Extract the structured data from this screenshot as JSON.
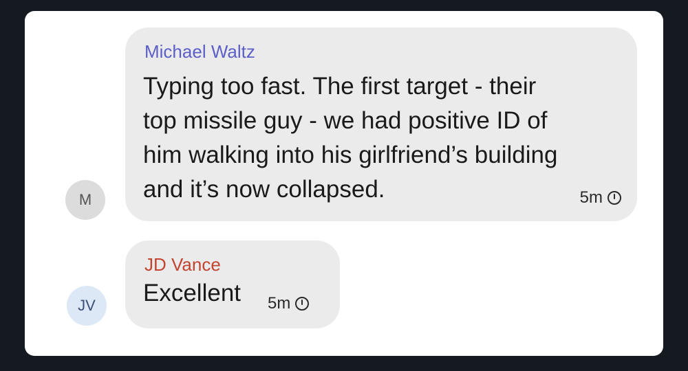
{
  "messages": [
    {
      "sender": "Michael Waltz",
      "sender_color": "#5b5fc7",
      "avatar_initials": "M",
      "lines": [
        "Typing too fast. The first target - their",
        "top missile guy - we had positive ID of",
        "him walking into his girlfriend’s building",
        "and it’s now collapsed."
      ],
      "time": "5m",
      "time_icon": "clock-icon"
    },
    {
      "sender": "JD Vance",
      "sender_color": "#c4452f",
      "avatar_initials": "JV",
      "lines": [
        "Excellent"
      ],
      "time": "5m",
      "time_icon": "clock-icon"
    }
  ]
}
